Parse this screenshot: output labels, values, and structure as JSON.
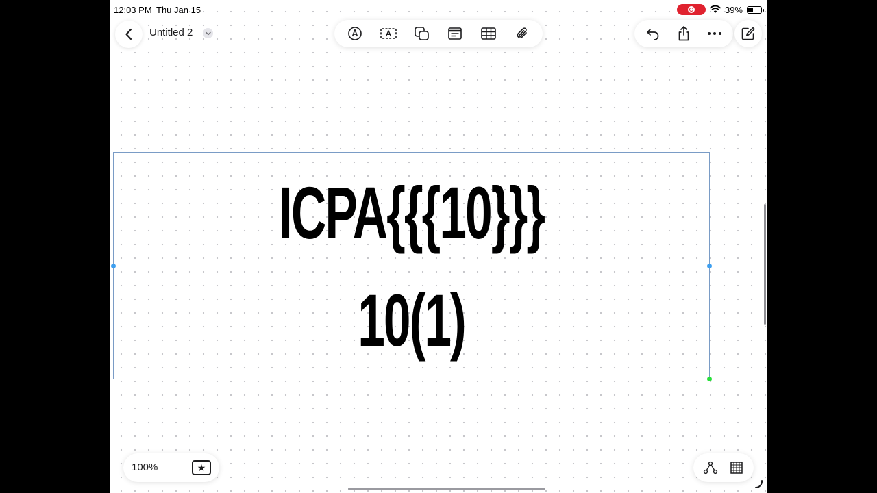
{
  "status_bar": {
    "time": "12:03 PM",
    "date": "Thu Jan 15",
    "battery_percent": "39%",
    "battery_level": 0.39,
    "recording_color": "#e0222f"
  },
  "header": {
    "title": "Untitled 2",
    "back_icon": "chevron-left-icon",
    "title_menu_icon": "chevron-down-icon",
    "tools": [
      {
        "name": "pen-tool-icon"
      },
      {
        "name": "text-box-icon"
      },
      {
        "name": "shapes-icon"
      },
      {
        "name": "sticky-note-icon"
      },
      {
        "name": "table-icon"
      },
      {
        "name": "paperclip-icon"
      }
    ],
    "actions": [
      {
        "name": "undo-icon"
      },
      {
        "name": "share-icon"
      },
      {
        "name": "more-icon"
      }
    ],
    "compose_icon": "compose-icon"
  },
  "canvas": {
    "text_lines": [
      "ICPA{{{10}}}",
      "10(1)"
    ],
    "selection_color": "#7a9cc6",
    "handle_color": "#3d9ff0",
    "corner_handle_color": "#28e03a"
  },
  "footer": {
    "zoom": "100%",
    "favorite_icon": "star-box-icon",
    "connector_icon": "connector-icon",
    "grid_icon": "grid-icon"
  }
}
